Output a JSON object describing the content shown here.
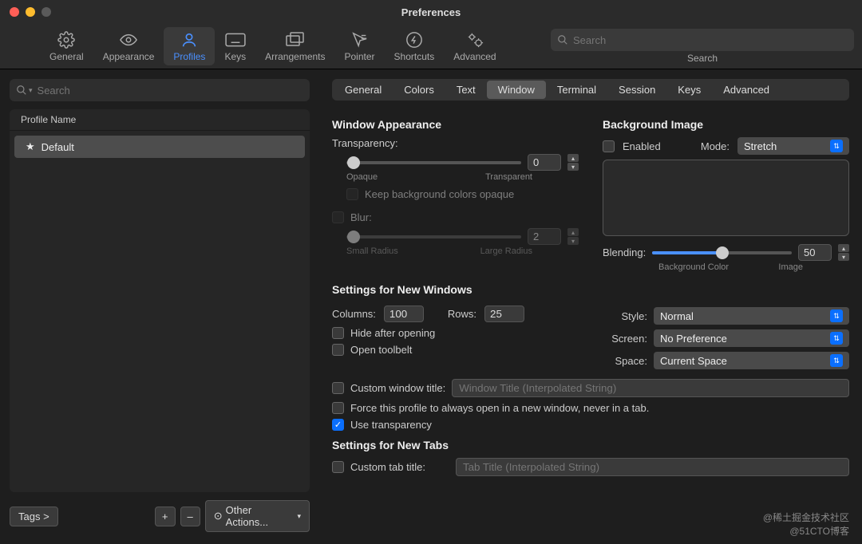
{
  "window": {
    "title": "Preferences"
  },
  "traffic": {
    "close": "#ff5f57",
    "min": "#febc2e",
    "max": "#5a5a5a"
  },
  "toolbar": {
    "items": [
      {
        "label": "General"
      },
      {
        "label": "Appearance"
      },
      {
        "label": "Profiles",
        "selected": true
      },
      {
        "label": "Keys"
      },
      {
        "label": "Arrangements"
      },
      {
        "label": "Pointer"
      },
      {
        "label": "Shortcuts"
      },
      {
        "label": "Advanced"
      }
    ],
    "search_placeholder": "Search",
    "search_label": "Search"
  },
  "sidebar": {
    "search_placeholder": "Search",
    "header": "Profile Name",
    "items": [
      {
        "name": "Default",
        "starred": true
      }
    ],
    "tags_label": "Tags >",
    "add": "+",
    "remove": "–",
    "other_actions": "Other Actions..."
  },
  "tabs": [
    "General",
    "Colors",
    "Text",
    "Window",
    "Terminal",
    "Session",
    "Keys",
    "Advanced"
  ],
  "tabs_selected": "Window",
  "panel": {
    "window_appearance": {
      "title": "Window Appearance",
      "transparency": {
        "label": "Transparency:",
        "value": "0",
        "min_label": "Opaque",
        "max_label": "Transparent"
      },
      "keep_opaque": "Keep background colors opaque",
      "blur": {
        "label": "Blur:",
        "value": "2",
        "min_label": "Small Radius",
        "max_label": "Large Radius"
      }
    },
    "background_image": {
      "title": "Background Image",
      "enabled_label": "Enabled",
      "mode_label": "Mode:",
      "mode_value": "Stretch",
      "blending": {
        "label": "Blending:",
        "value": "50",
        "min_label": "Background Color",
        "max_label": "Image"
      }
    },
    "new_windows": {
      "title": "Settings for New Windows",
      "columns_label": "Columns:",
      "columns": "100",
      "rows_label": "Rows:",
      "rows": "25",
      "hide_after": "Hide after opening",
      "open_toolbelt": "Open toolbelt",
      "custom_title_label": "Custom window title:",
      "custom_title_placeholder": "Window Title (Interpolated String)",
      "force_new_window": "Force this profile to always open in a new window, never in a tab.",
      "use_transparency": "Use transparency",
      "style_label": "Style:",
      "style_value": "Normal",
      "screen_label": "Screen:",
      "screen_value": "No Preference",
      "space_label": "Space:",
      "space_value": "Current Space"
    },
    "new_tabs": {
      "title": "Settings for New Tabs",
      "custom_title_label": "Custom tab title:",
      "custom_title_placeholder": "Tab Title (Interpolated String)"
    }
  },
  "watermark": {
    "l1": "@稀土掘金技术社区",
    "l2": "@51CTO博客"
  }
}
